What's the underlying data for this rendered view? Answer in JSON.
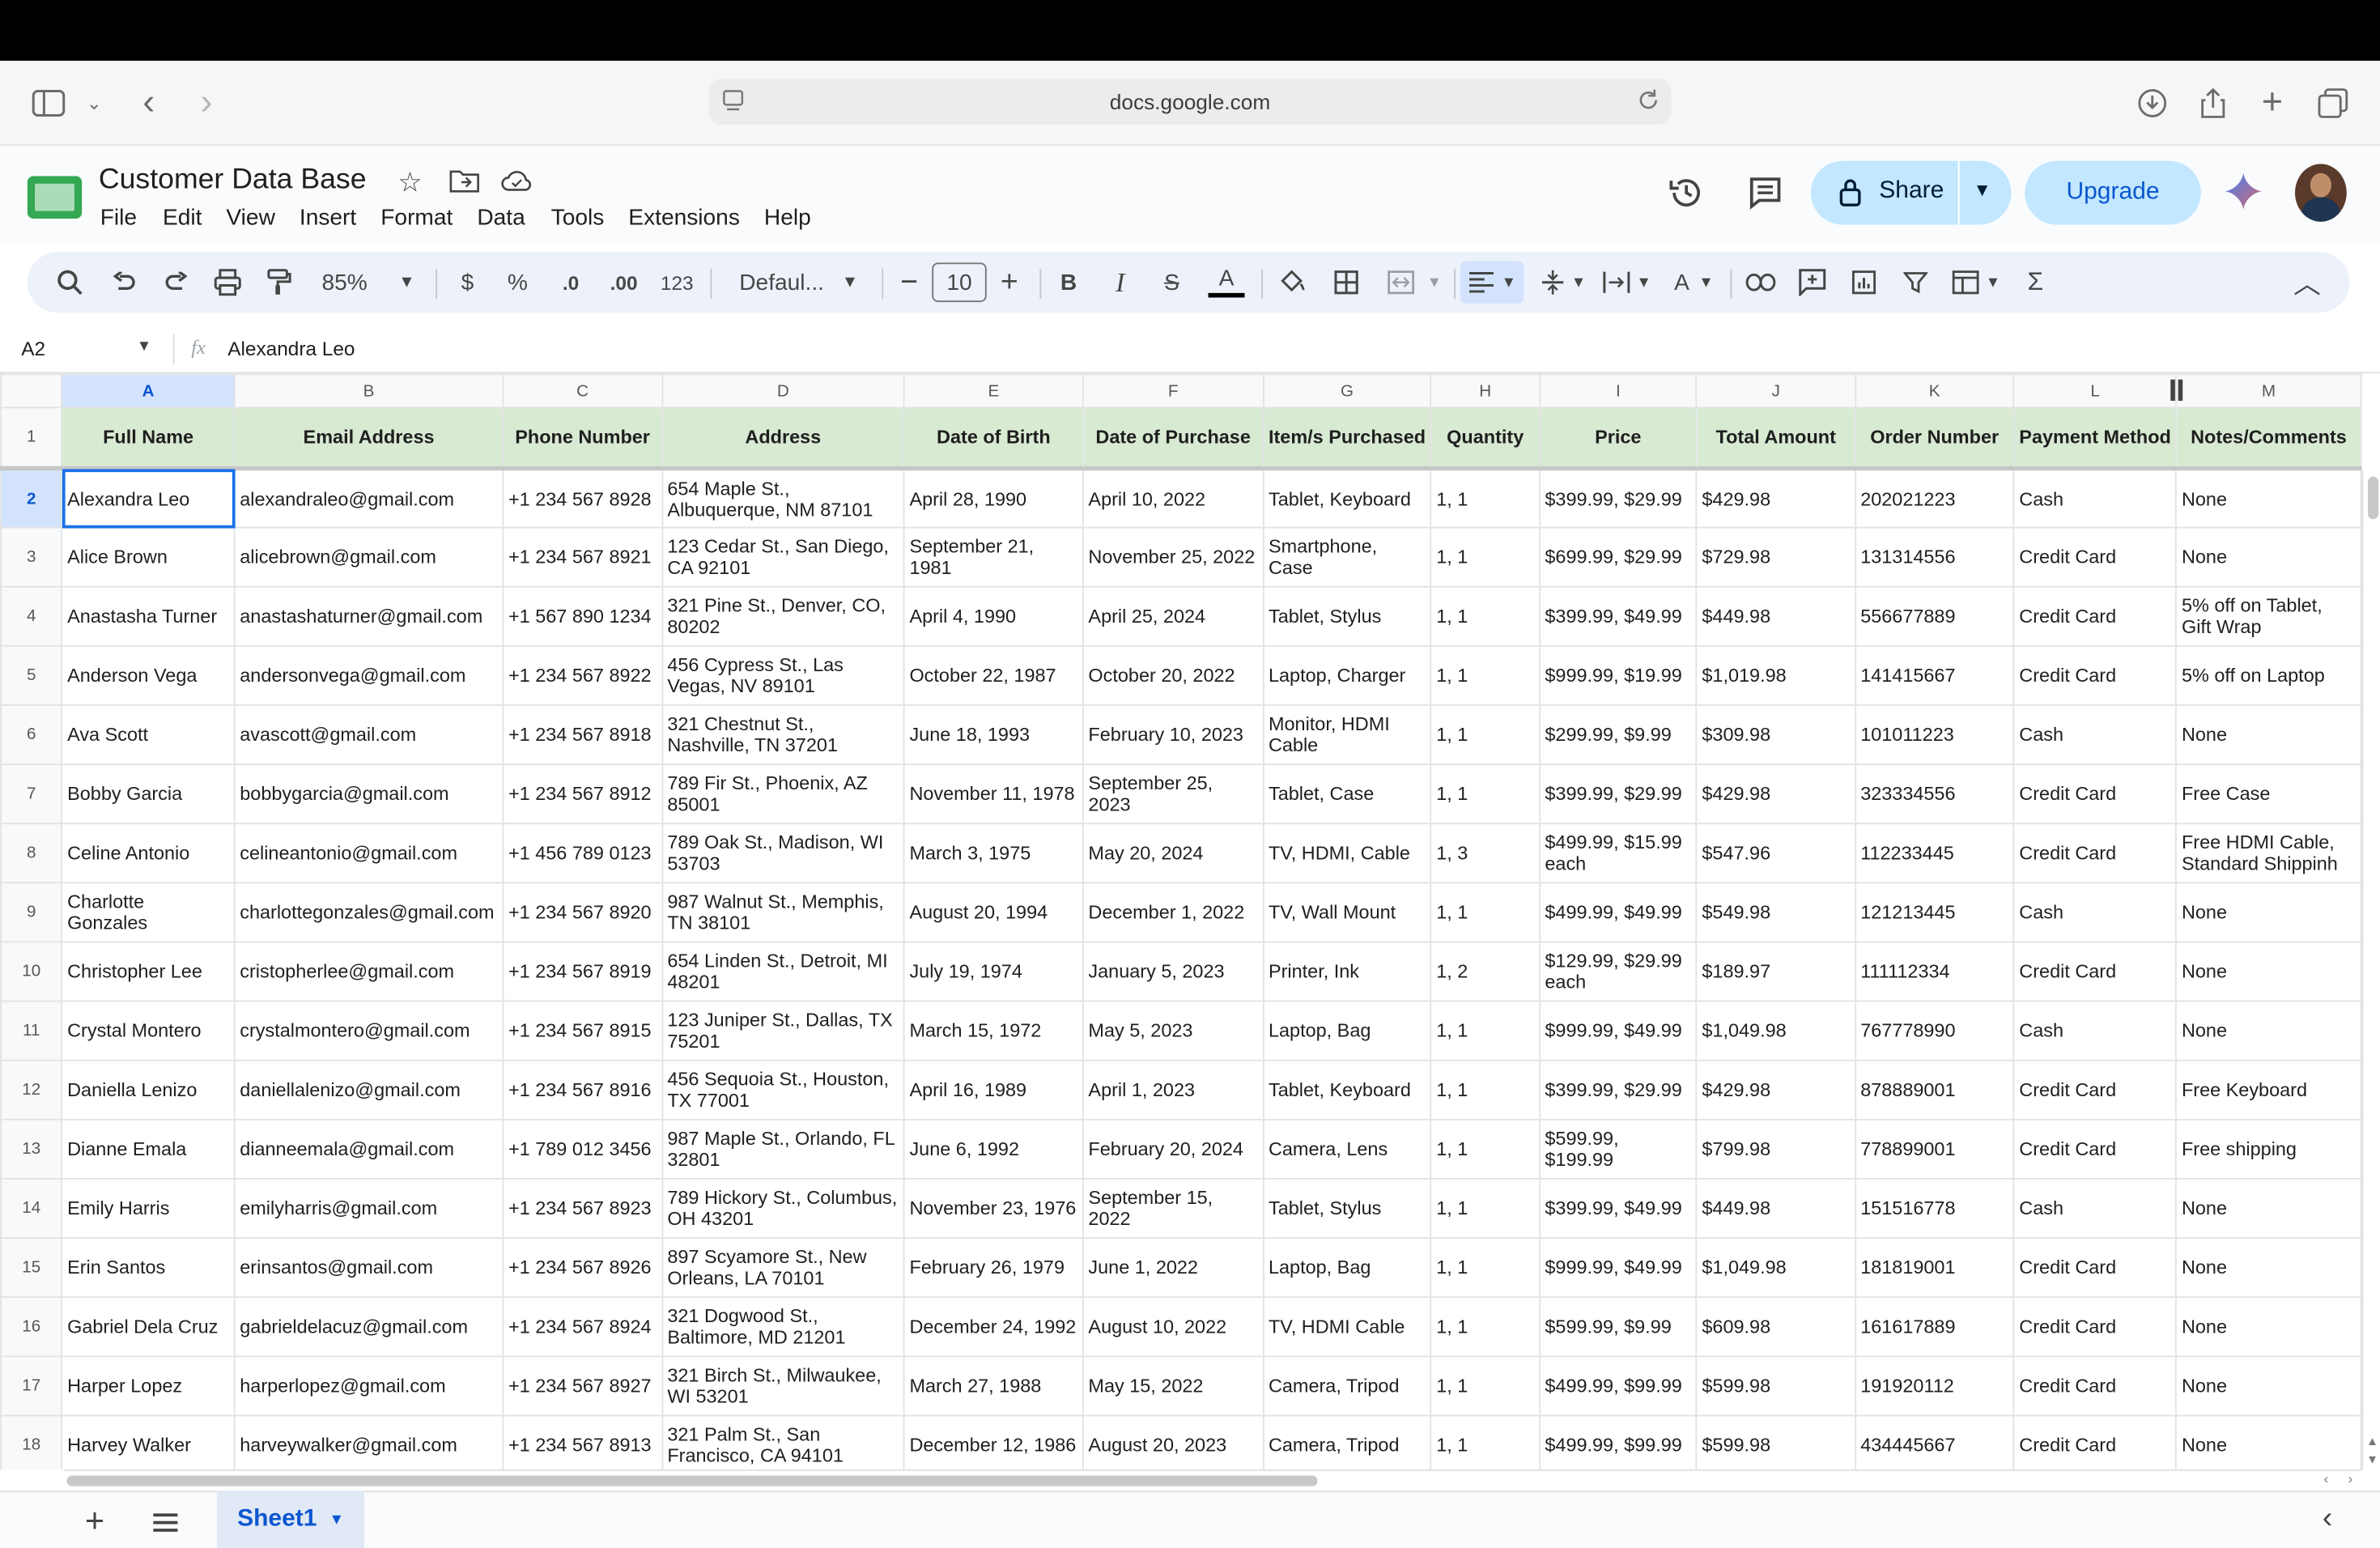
{
  "browser": {
    "url": "docs.google.com"
  },
  "doc": {
    "title": "Customer Data Base",
    "menu": [
      "File",
      "Edit",
      "View",
      "Insert",
      "Format",
      "Data",
      "Tools",
      "Extensions",
      "Help"
    ],
    "share_label": "Share",
    "upgrade_label": "Upgrade"
  },
  "toolbar": {
    "zoom": "85%",
    "currency": "$",
    "percent": "%",
    "dec_decrease": ".0",
    "dec_increase": ".00",
    "number_format": "123",
    "font": "Defaul...",
    "font_size": "10"
  },
  "formula_bar": {
    "cell_ref": "A2",
    "fx": "fx",
    "content": "Alexandra Leo"
  },
  "sheet": {
    "column_letters": [
      "A",
      "B",
      "C",
      "D",
      "E",
      "F",
      "G",
      "H",
      "I",
      "J",
      "K",
      "L",
      "M"
    ],
    "headers": [
      "Full Name",
      "Email Address",
      "Phone Number",
      "Address",
      "Date of Birth",
      "Date of Purchase",
      "Item/s Purchased",
      "Quantity",
      "Price",
      "Total Amount",
      "Order Number",
      "Payment Method",
      "Notes/Comments"
    ],
    "rows": [
      {
        "n": "2",
        "cells": [
          "Alexandra Leo",
          "alexandraleo@gmail.com",
          "+1 234 567 8928",
          "654 Maple St., Albuquerque, NM 87101",
          "April 28, 1990",
          "April 10, 2022",
          "Tablet, Keyboard",
          "1, 1",
          "$399.99, $29.99",
          "$429.98",
          "202021223",
          "Cash",
          "None"
        ]
      },
      {
        "n": "3",
        "cells": [
          "Alice Brown",
          "alicebrown@gmail.com",
          "+1 234 567 8921",
          "123 Cedar St., San Diego, CA 92101",
          "September 21, 1981",
          "November 25, 2022",
          "Smartphone, Case",
          "1, 1",
          "$699.99, $29.99",
          "$729.98",
          "131314556",
          "Credit Card",
          "None"
        ]
      },
      {
        "n": "4",
        "cells": [
          "Anastasha Turner",
          "anastashaturner@gmail.com",
          "+1 567 890 1234",
          "321 Pine St., Denver, CO, 80202",
          "April 4, 1990",
          "April 25, 2024",
          "Tablet, Stylus",
          "1, 1",
          "$399.99, $49.99",
          "$449.98",
          "556677889",
          "Credit Card",
          "5% off on Tablet, Gift Wrap"
        ]
      },
      {
        "n": "5",
        "cells": [
          "Anderson Vega",
          "andersonvega@gmail.com",
          "+1 234 567 8922",
          "456 Cypress St., Las Vegas, NV 89101",
          "October 22, 1987",
          "October 20, 2022",
          "Laptop, Charger",
          "1, 1",
          "$999.99, $19.99",
          "$1,019.98",
          "141415667",
          "Credit Card",
          "5% off on Laptop"
        ]
      },
      {
        "n": "6",
        "cells": [
          "Ava Scott",
          "avascott@gmail.com",
          "+1 234 567 8918",
          "321 Chestnut St., Nashville, TN 37201",
          "June 18, 1993",
          "February 10, 2023",
          "Monitor, HDMI Cable",
          "1, 1",
          "$299.99, $9.99",
          "$309.98",
          "101011223",
          "Cash",
          "None"
        ]
      },
      {
        "n": "7",
        "cells": [
          "Bobby Garcia",
          "bobbygarcia@gmail.com",
          "+1 234 567 8912",
          "789 Fir St., Phoenix, AZ 85001",
          "November 11, 1978",
          "September 25, 2023",
          "Tablet, Case",
          "1, 1",
          "$399.99, $29.99",
          "$429.98",
          "323334556",
          "Credit Card",
          "Free Case"
        ]
      },
      {
        "n": "8",
        "cells": [
          "Celine Antonio",
          "celineantonio@gmail.com",
          "+1 456 789 0123",
          "789 Oak St., Madison, WI 53703",
          "March 3, 1975",
          "May 20, 2024",
          "TV, HDMI, Cable",
          "1, 3",
          "$499.99, $15.99 each",
          "$547.96",
          "112233445",
          "Credit Card",
          "Free HDMI Cable, Standard Shippinh"
        ]
      },
      {
        "n": "9",
        "cells": [
          "Charlotte Gonzales",
          "charlottegonzales@gmail.com",
          "+1 234 567 8920",
          "987 Walnut St., Memphis, TN 38101",
          "August 20, 1994",
          "December 1, 2022",
          "TV, Wall Mount",
          "1, 1",
          "$499.99, $49.99",
          "$549.98",
          "121213445",
          "Cash",
          "None"
        ]
      },
      {
        "n": "10",
        "cells": [
          "Christopher Lee",
          "cristopherlee@gmail.com",
          "+1 234 567 8919",
          "654 Linden St., Detroit, MI 48201",
          "July 19, 1974",
          "January 5, 2023",
          "Printer, Ink",
          "1, 2",
          "$129.99, $29.99 each",
          "$189.97",
          "111112334",
          "Credit Card",
          "None"
        ]
      },
      {
        "n": "11",
        "cells": [
          "Crystal Montero",
          "crystalmontero@gmail.com",
          "+1 234 567 8915",
          "123 Juniper St., Dallas, TX 75201",
          "March 15, 1972",
          "May 5, 2023",
          "Laptop, Bag",
          "1, 1",
          "$999.99, $49.99",
          "$1,049.98",
          "767778990",
          "Cash",
          "None"
        ]
      },
      {
        "n": "12",
        "cells": [
          "Daniella Lenizo",
          "daniellalenizo@gmail.com",
          "+1 234 567 8916",
          "456 Sequoia St., Houston, TX 77001",
          "April 16, 1989",
          "April 1, 2023",
          "Tablet, Keyboard",
          "1, 1",
          "$399.99, $29.99",
          "$429.98",
          "878889001",
          "Credit Card",
          "Free Keyboard"
        ]
      },
      {
        "n": "13",
        "cells": [
          "Dianne Emala",
          "dianneemala@gmail.com",
          "+1 789 012 3456",
          "987 Maple St., Orlando, FL 32801",
          "June 6, 1992",
          "February 20, 2024",
          "Camera, Lens",
          "1, 1",
          "$599.99, $199.99",
          "$799.98",
          "778899001",
          "Credit Card",
          "Free shipping"
        ]
      },
      {
        "n": "14",
        "cells": [
          "Emily Harris",
          "emilyharris@gmail.com",
          "+1 234 567 8923",
          "789 Hickory St., Columbus, OH 43201",
          "November 23, 1976",
          "September 15, 2022",
          "Tablet, Stylus",
          "1, 1",
          "$399.99, $49.99",
          "$449.98",
          "151516778",
          "Cash",
          "None"
        ]
      },
      {
        "n": "15",
        "cells": [
          "Erin Santos",
          "erinsantos@gmail.com",
          "+1 234 567 8926",
          "897 Scyamore St., New Orleans, LA 70101",
          "February 26, 1979",
          "June 1, 2022",
          "Laptop, Bag",
          "1, 1",
          "$999.99, $49.99",
          "$1,049.98",
          "181819001",
          "Credit Card",
          "None"
        ]
      },
      {
        "n": "16",
        "cells": [
          "Gabriel Dela Cruz",
          "gabrieldelacuz@gmail.com",
          "+1 234 567 8924",
          "321 Dogwood St., Baltimore, MD 21201",
          "December 24, 1992",
          "August 10, 2022",
          "TV, HDMI Cable",
          "1, 1",
          "$599.99, $9.99",
          "$609.98",
          "161617889",
          "Credit Card",
          "None"
        ]
      },
      {
        "n": "17",
        "cells": [
          "Harper Lopez",
          "harperlopez@gmail.com",
          "+1 234 567 8927",
          "321 Birch St., Milwaukee, WI 53201",
          "March 27, 1988",
          "May 15, 2022",
          "Camera, Tripod",
          "1, 1",
          "$499.99, $99.99",
          "$599.98",
          "191920112",
          "Credit Card",
          "None"
        ]
      },
      {
        "n": "18",
        "cells": [
          "Harvey Walker",
          "harveywalker@gmail.com",
          "+1 234 567 8913",
          "321 Palm St., San Francisco, CA 94101",
          "December 12, 1986",
          "August 20, 2023",
          "Camera, Tripod",
          "1, 1",
          "$499.99, $99.99",
          "$599.98",
          "434445667",
          "Credit Card",
          "None"
        ]
      }
    ]
  },
  "tabs": {
    "active": "Sheet1"
  }
}
